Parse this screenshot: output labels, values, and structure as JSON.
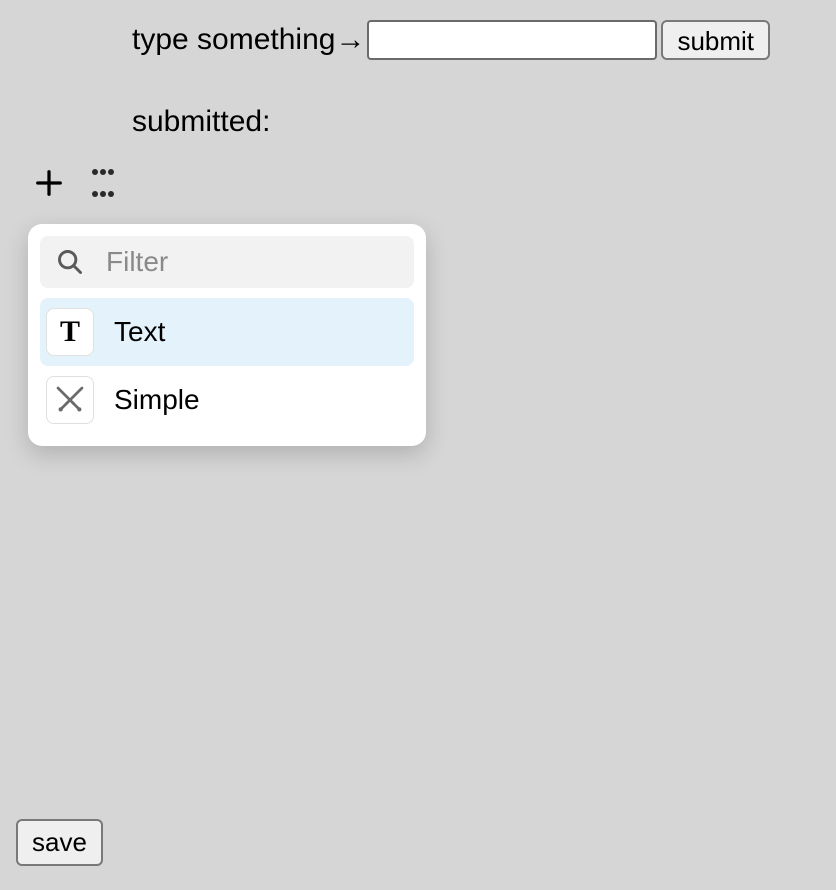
{
  "form": {
    "label": "type something→",
    "input_value": "",
    "input_placeholder": "",
    "submit_label": "submit"
  },
  "submitted": {
    "label": "submitted:"
  },
  "popup": {
    "filter_placeholder": "Filter",
    "items": [
      {
        "label": "Text",
        "icon": "text-icon",
        "highlighted": true
      },
      {
        "label": "Simple",
        "icon": "swords-icon",
        "highlighted": false
      }
    ]
  },
  "footer": {
    "save_label": "save"
  }
}
